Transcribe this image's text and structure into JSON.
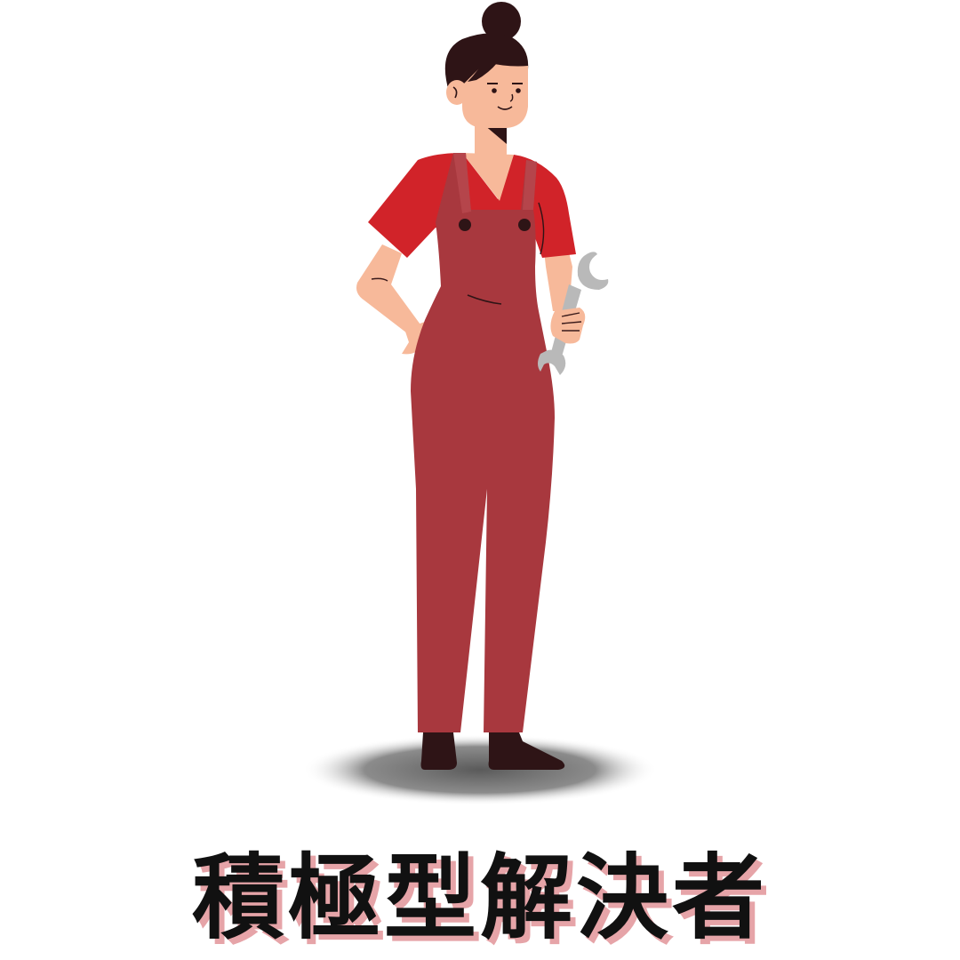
{
  "caption": {
    "text": "積極型解決者"
  },
  "illustration": {
    "subject": "woman-mechanic",
    "held_tool": "wrench-icon",
    "colors": {
      "background": "#ffffff",
      "shirt": "#d12329",
      "overalls": "#a8383e",
      "skin": "#f7b99a",
      "hair": "#2e1416",
      "shoes": "#2e1416",
      "wrench": "#b9b9b9",
      "shadow": "#6b6b6b",
      "caption_text": "#111111",
      "caption_shadow": "#e6a4a8"
    }
  }
}
